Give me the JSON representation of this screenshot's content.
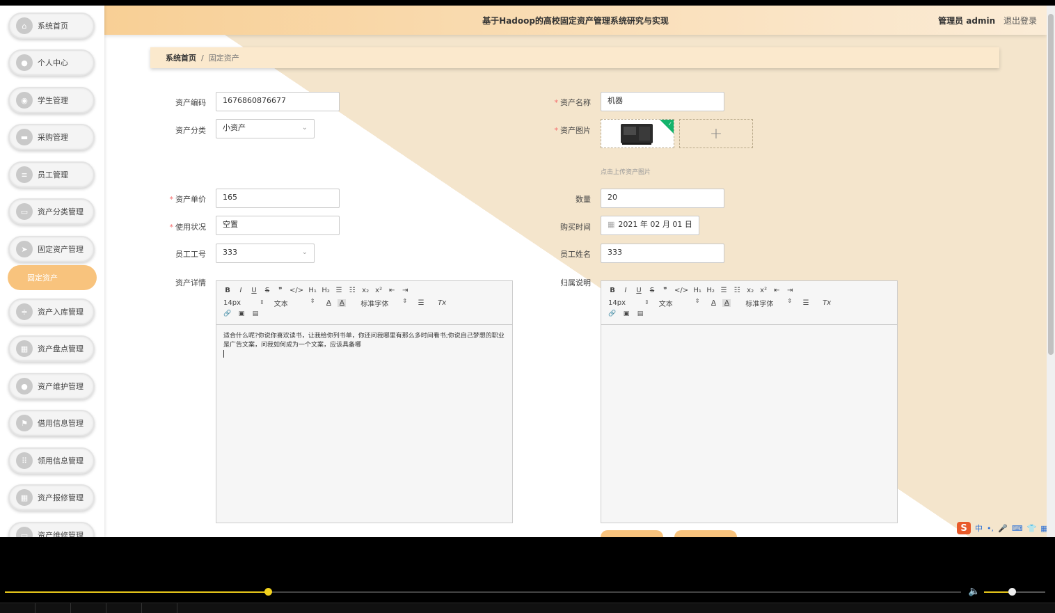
{
  "header": {
    "title": "基于Hadoop的高校固定资产管理系统研究与实现",
    "role": "管理员",
    "username": "admin",
    "logout": "退出登录"
  },
  "breadcrumb": {
    "home": "系统首页",
    "separator": "/",
    "current": "固定资产"
  },
  "sidebar": {
    "items": [
      {
        "label": "系统首页",
        "icon": "home-icon"
      },
      {
        "label": "个人中心",
        "icon": "user-icon"
      },
      {
        "label": "学生管理",
        "icon": "bulb-icon"
      },
      {
        "label": "采购管理",
        "icon": "bag-icon"
      },
      {
        "label": "员工管理",
        "icon": "list-icon"
      },
      {
        "label": "资产分类管理",
        "icon": "monitor-icon"
      },
      {
        "label": "固定资产管理",
        "icon": "send-icon"
      },
      {
        "label": "资产入库管理",
        "icon": "sliders-icon"
      },
      {
        "label": "资产盘点管理",
        "icon": "grid-icon"
      },
      {
        "label": "资产维护管理",
        "icon": "user-icon"
      },
      {
        "label": "借用信息管理",
        "icon": "flag-icon"
      },
      {
        "label": "领用信息管理",
        "icon": "apps-icon"
      },
      {
        "label": "资产报修管理",
        "icon": "grid-icon"
      },
      {
        "label": "资产维修管理",
        "icon": "monitor-icon"
      }
    ],
    "active_sub": "固定资产"
  },
  "form": {
    "asset_code": {
      "label": "资产编码",
      "value": "1676860876677"
    },
    "asset_name": {
      "label": "资产名称",
      "value": "机器"
    },
    "asset_category": {
      "label": "资产分类",
      "value": "小资产"
    },
    "asset_image": {
      "label": "资产图片",
      "hint": "点击上传资产图片"
    },
    "unit_price": {
      "label": "资产单价",
      "value": "165"
    },
    "quantity": {
      "label": "数量",
      "value": "20"
    },
    "usage_status": {
      "label": "使用状况",
      "value": "空置"
    },
    "purchase_date": {
      "label": "购买时间",
      "value": "2021 年 02 月 01 日"
    },
    "employee_no": {
      "label": "员工工号",
      "value": "333"
    },
    "employee_name": {
      "label": "员工姓名",
      "value": "333"
    },
    "asset_detail": {
      "label": "资产详情",
      "content": "适合什么呢?你说你喜欢读书，让我给你列书单，你还问我哪里有那么多时间看书;你说自己梦想的职业是广告文案，问我如何成为一个文案，应该具备哪"
    },
    "ownership_note": {
      "label": "归属说明",
      "content": ""
    }
  },
  "editor_toolbar": {
    "row1": [
      "B",
      "I",
      "U",
      "S",
      "❞",
      "</>",
      "H₁",
      "H₂",
      "☰",
      "☷",
      "x₂",
      "x²",
      "⇤",
      "⇥"
    ],
    "font_size": "14px",
    "text_style": "文本",
    "font_family": "标准字体",
    "row3": [
      "🔗",
      "▣",
      "▤"
    ]
  },
  "ime": {
    "lang": "中"
  },
  "player": {
    "progress_percent": 27.5,
    "volume_percent": 45
  },
  "colors": {
    "accent": "#f8c37d",
    "header_start": "#f8cf95",
    "progress": "#e8c81a"
  }
}
